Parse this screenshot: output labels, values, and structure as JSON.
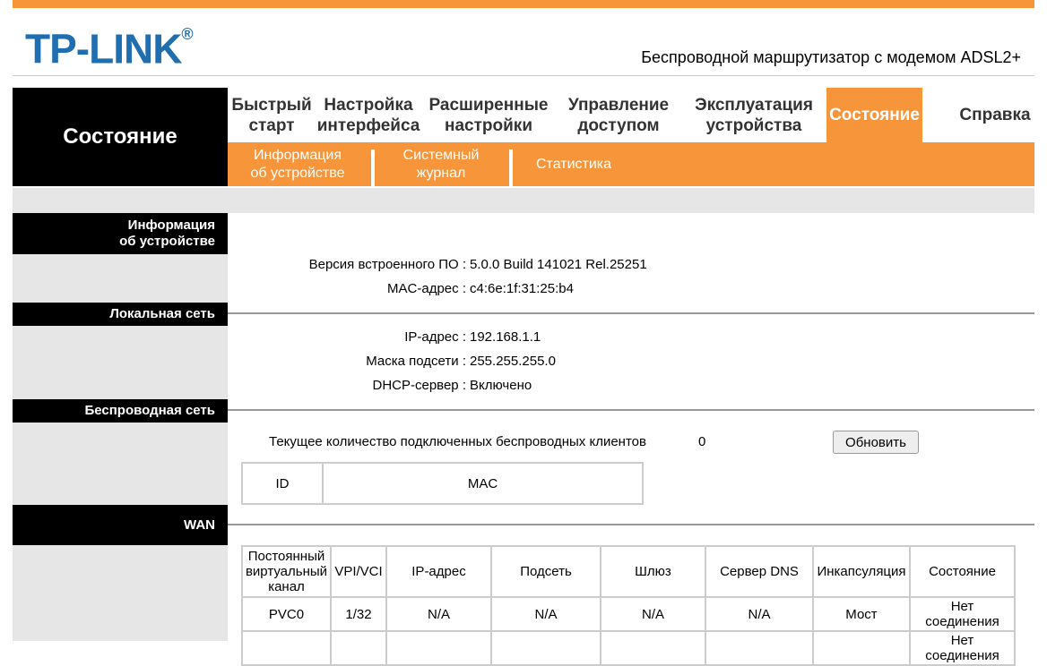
{
  "brand": {
    "logo": "TP-LINK",
    "product": "Беспроводной маршрутизатор с модемом ADSL2+"
  },
  "colors": {
    "accent": "#f7953a",
    "logo": "#1f6fb0",
    "section_bg": "#000000",
    "panel_gray": "#e6e6e6"
  },
  "nav": {
    "current": "Состояние",
    "tabs": [
      {
        "label": "Быстрый\nстарт"
      },
      {
        "label": "Настройка\nинтерфейса"
      },
      {
        "label": "Расширенные\nнастройки"
      },
      {
        "label": "Управление\nдоступом"
      },
      {
        "label": "Эксплуатация\nустройства"
      },
      {
        "label": "Состояние"
      },
      {
        "label": "Справка"
      }
    ],
    "subtabs": [
      {
        "label": "Информация\nоб устройстве"
      },
      {
        "label": "Системный\nжурнал"
      },
      {
        "label": "Статистика"
      }
    ]
  },
  "device_info": {
    "title": "Информация\nоб устройстве",
    "firmware_label": "Версия встроенного ПО :",
    "firmware_value": "5.0.0 Build 141021 Rel.25251",
    "mac_label": "MAC-адрес :",
    "mac_value": "c4:6e:1f:31:25:b4"
  },
  "lan": {
    "title": "Локальная сеть",
    "ip_label": "IP-адрес :",
    "ip_value": "192.168.1.1",
    "mask_label": "Маска подсети :",
    "mask_value": "255.255.255.0",
    "dhcp_label": "DHCP-сервер :",
    "dhcp_value": "Включено"
  },
  "wireless": {
    "title": "Беспроводная сеть",
    "clients_label": "Текущее количество подключенных беспроводных клиентов",
    "clients_value": "0",
    "refresh_label": "Обновить",
    "table_headers": [
      "ID",
      "MAC"
    ]
  },
  "wan": {
    "title": "WAN",
    "headers": [
      "Постоянный\nвиртуальный\nканал",
      "VPI/VCI",
      "IP-адрес",
      "Подсеть",
      "Шлюз",
      "Сервер DNS",
      "Инкапсуляция",
      "Состояние"
    ],
    "rows": [
      [
        "PVC0",
        "1/32",
        "N/A",
        "N/A",
        "N/A",
        "N/A",
        "Мост",
        "Нет\nсоединения"
      ],
      [
        "",
        "",
        "",
        "",
        "",
        "",
        "",
        "Нет\nсоединения"
      ]
    ]
  }
}
